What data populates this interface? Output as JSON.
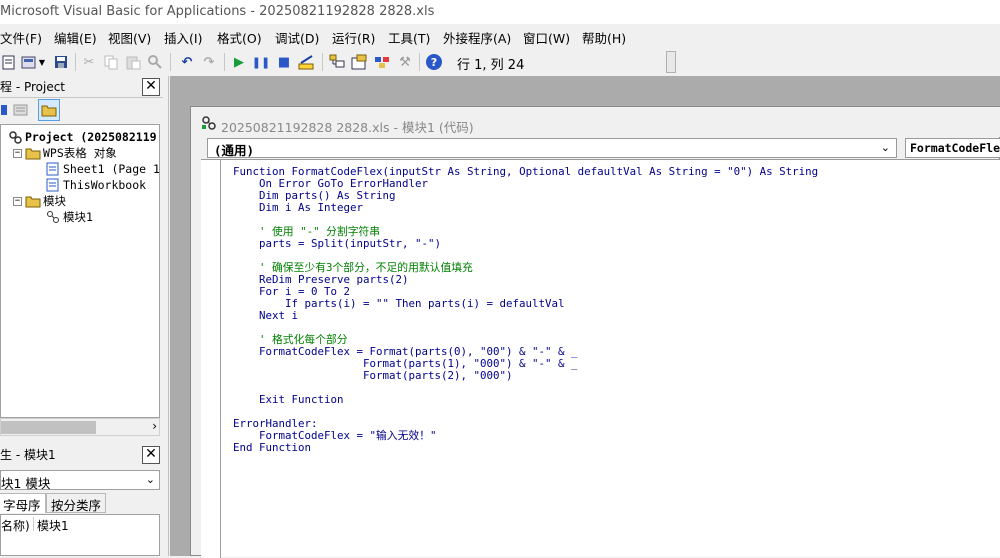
{
  "window": {
    "title": "Microsoft Visual Basic for Applications - 20250821192828 2828.xls"
  },
  "menu": {
    "items": [
      "文件(F)",
      "编辑(E)",
      "视图(V)",
      "插入(I)",
      "格式(O)",
      "调试(D)",
      "运行(R)",
      "工具(T)",
      "外接程序(A)",
      "窗口(W)",
      "帮助(H)"
    ]
  },
  "toolbar": {
    "cursor_position": "行 1, 列 24",
    "icons": [
      "view-excel-icon",
      "insert-module-icon",
      "save-icon",
      "cut-icon",
      "copy-icon",
      "paste-icon",
      "find-icon",
      "undo-icon",
      "redo-icon",
      "run-icon",
      "break-icon",
      "reset-icon",
      "design-mode-icon",
      "project-explorer-icon",
      "properties-icon",
      "object-browser-icon",
      "toolbox-icon",
      "help-icon"
    ]
  },
  "project_panel": {
    "title": "程 - Project",
    "tree": {
      "root": "Project (2025082119",
      "folder_objects": "WPS表格 对象",
      "sheet1": "Sheet1 (Page 1)",
      "thisworkbook": "ThisWorkbook",
      "folder_modules": "模块",
      "module1": "模块1"
    }
  },
  "properties_panel": {
    "title": "生 - 模块1",
    "object_combo": "块1 模块",
    "tab_alpha": "字母序",
    "tab_category": "按分类序",
    "row_name": "名称)",
    "row_value": "模块1"
  },
  "code_window": {
    "title": "20250821192828 2828.xls - 模块1 (代码)",
    "object_combo": "(通用)",
    "procedure_combo": "FormatCodeFlex",
    "lines": [
      [
        {
          "t": "kw",
          "v": "Function "
        },
        {
          "t": "tx",
          "v": "FormatCodeFlex(inputStr "
        },
        {
          "t": "kw",
          "v": "As String"
        },
        {
          "t": "tx",
          "v": ", "
        },
        {
          "t": "kw",
          "v": "Optional "
        },
        {
          "t": "tx",
          "v": "defaultVal "
        },
        {
          "t": "kw",
          "v": "As String"
        },
        {
          "t": "tx",
          "v": " = \"0\") "
        },
        {
          "t": "kw",
          "v": "As String"
        }
      ],
      [
        {
          "t": "kw",
          "v": "    On Error GoTo "
        },
        {
          "t": "tx",
          "v": "ErrorHandler"
        }
      ],
      [
        {
          "t": "kw",
          "v": "    Dim "
        },
        {
          "t": "tx",
          "v": "parts() "
        },
        {
          "t": "kw",
          "v": "As String"
        }
      ],
      [
        {
          "t": "kw",
          "v": "    Dim "
        },
        {
          "t": "tx",
          "v": "i "
        },
        {
          "t": "kw",
          "v": "As Integer"
        }
      ],
      [
        {
          "t": "tx",
          "v": ""
        }
      ],
      [
        {
          "t": "cm",
          "v": "    ' 使用 \"-\" 分割字符串"
        }
      ],
      [
        {
          "t": "tx",
          "v": "    parts = Split(inputStr, \"-\")"
        }
      ],
      [
        {
          "t": "tx",
          "v": ""
        }
      ],
      [
        {
          "t": "cm",
          "v": "    ' 确保至少有3个部分，不足的用默认值填充"
        }
      ],
      [
        {
          "t": "kw",
          "v": "    ReDim Preserve "
        },
        {
          "t": "tx",
          "v": "parts(2)"
        }
      ],
      [
        {
          "t": "kw",
          "v": "    For "
        },
        {
          "t": "tx",
          "v": "i = 0 "
        },
        {
          "t": "kw",
          "v": "To "
        },
        {
          "t": "tx",
          "v": "2"
        }
      ],
      [
        {
          "t": "kw",
          "v": "        If "
        },
        {
          "t": "tx",
          "v": "parts(i) = \"\" "
        },
        {
          "t": "kw",
          "v": "Then "
        },
        {
          "t": "tx",
          "v": "parts(i) = defaultVal"
        }
      ],
      [
        {
          "t": "kw",
          "v": "    Next "
        },
        {
          "t": "tx",
          "v": "i"
        }
      ],
      [
        {
          "t": "tx",
          "v": ""
        }
      ],
      [
        {
          "t": "cm",
          "v": "    ' 格式化每个部分"
        }
      ],
      [
        {
          "t": "tx",
          "v": "    FormatCodeFlex = Format(parts(0), \"00\") & \"-\" & _"
        }
      ],
      [
        {
          "t": "tx",
          "v": "                    Format(parts(1), \"000\") & \"-\" & _"
        }
      ],
      [
        {
          "t": "tx",
          "v": "                    Format(parts(2), \"000\")"
        }
      ],
      [
        {
          "t": "tx",
          "v": ""
        }
      ],
      [
        {
          "t": "kw",
          "v": "    Exit Function"
        }
      ],
      [
        {
          "t": "tx",
          "v": ""
        }
      ],
      [
        {
          "t": "tx",
          "v": "ErrorHandler:"
        }
      ],
      [
        {
          "t": "tx",
          "v": "    FormatCodeFlex = \"输入无效！\""
        }
      ],
      [
        {
          "t": "kw",
          "v": "End Function"
        }
      ]
    ]
  }
}
